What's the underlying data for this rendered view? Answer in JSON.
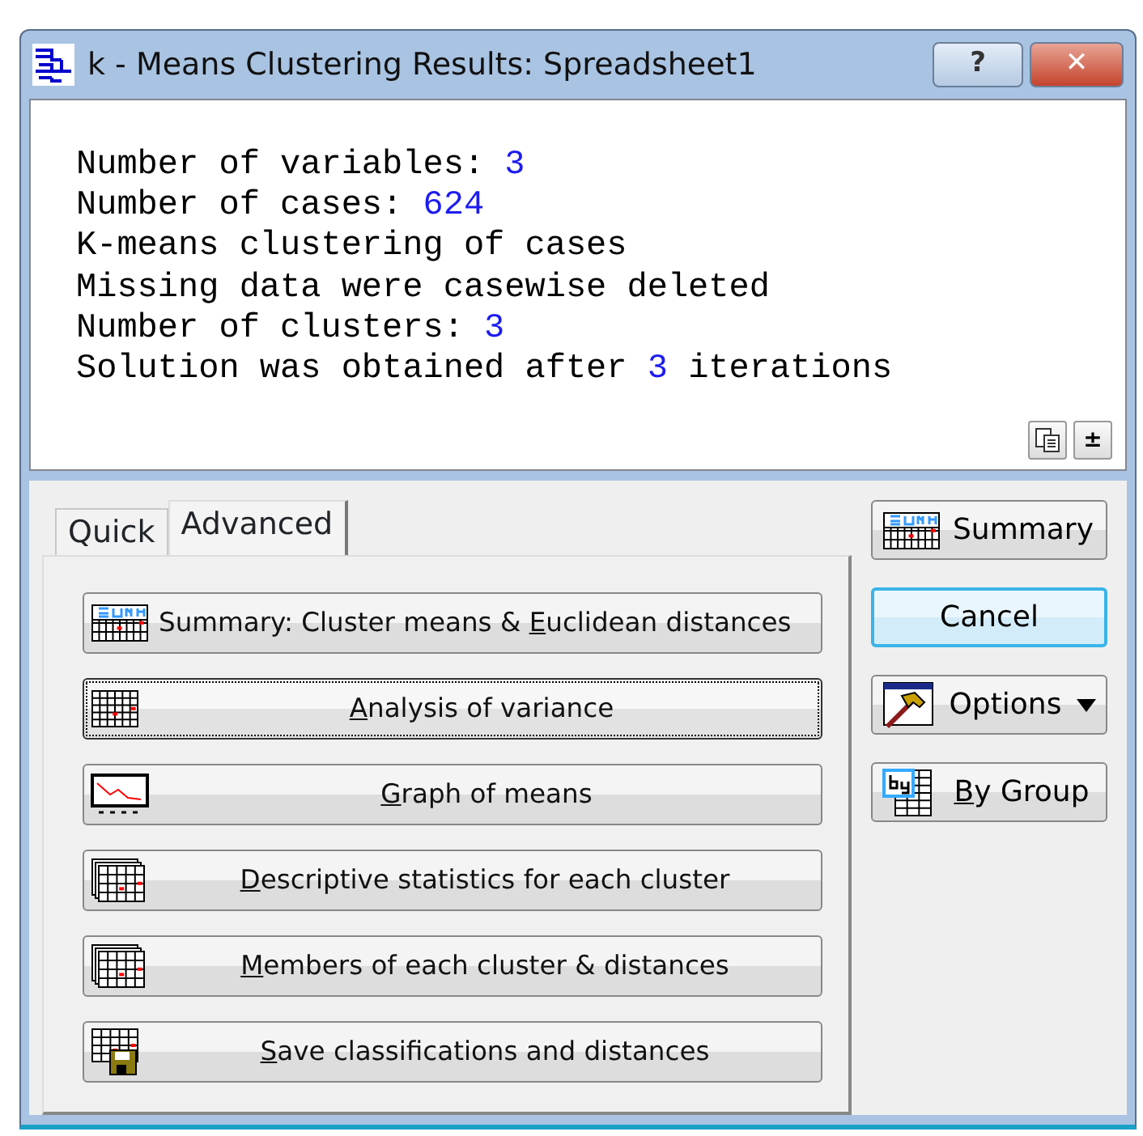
{
  "window": {
    "title": "k - Means Clustering Results: Spreadsheet1"
  },
  "title_buttons": [
    {
      "kind": "help",
      "label": "?"
    },
    {
      "kind": "close",
      "label": "✕"
    }
  ],
  "report": {
    "lines": [
      [
        {
          "kind": "text",
          "text": "Number of variables: "
        },
        {
          "kind": "value",
          "text": "3"
        }
      ],
      [
        {
          "kind": "text",
          "text": "Number of cases: "
        },
        {
          "kind": "value",
          "text": "624"
        }
      ],
      [
        {
          "kind": "text",
          "text": "K-means clustering of cases"
        }
      ],
      [
        {
          "kind": "text",
          "text": "Missing data were casewise deleted"
        }
      ],
      [
        {
          "kind": "text",
          "text": "Number of clusters: "
        },
        {
          "kind": "value",
          "text": "3"
        }
      ],
      [
        {
          "kind": "text",
          "text": "Solution was obtained after "
        },
        {
          "kind": "value",
          "text": "3"
        },
        {
          "kind": "text",
          "text": " iterations"
        }
      ]
    ],
    "tools": [
      {
        "kind": "copy"
      },
      {
        "kind": "expand",
        "label": "±"
      }
    ]
  },
  "tabs": [
    {
      "label": "Quick",
      "selected": false
    },
    {
      "label": "Advanced",
      "selected": true
    }
  ],
  "actions": [
    {
      "kind": "summary",
      "before": "Summary: Cluster means & ",
      "key": "E",
      "after": "uclidean distances",
      "focused": false
    },
    {
      "kind": "table",
      "key": "A",
      "after": "nalysis of variance",
      "focused": true
    },
    {
      "kind": "graph",
      "key": "G",
      "after": "raph of means",
      "focused": false
    },
    {
      "kind": "tables",
      "key": "D",
      "after": "escriptive statistics for each cluster",
      "focused": false
    },
    {
      "kind": "tables",
      "key": "M",
      "after": "embers of each cluster & distances",
      "focused": false
    },
    {
      "kind": "save",
      "key": "S",
      "after": "ave classifications and distances",
      "focused": false
    }
  ],
  "side_buttons": [
    {
      "kind": "summary",
      "before": "Summary",
      "default": false,
      "dropdown": false
    },
    {
      "kind": "plain",
      "before": "Cancel",
      "default": true,
      "dropdown": false
    },
    {
      "kind": "options",
      "before": "Options",
      "default": false,
      "dropdown": true
    },
    {
      "kind": "bygroup",
      "key": "B",
      "after": "y Group",
      "default": false,
      "dropdown": false
    }
  ]
}
